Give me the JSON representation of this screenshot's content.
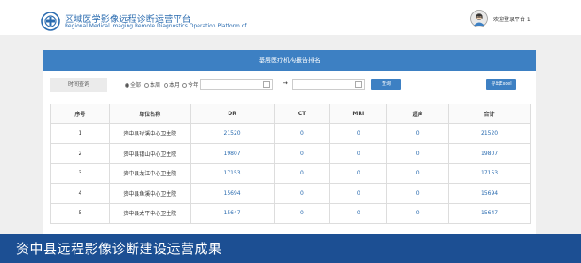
{
  "header": {
    "title_zh": "区域医学影像远程诊断运营平台",
    "title_en": "Regional Medical Imaging Remote Diagnostics Operation Platform of",
    "welcome": "欢迎登录平台 1",
    "logo_icon": "hospital-logo-icon",
    "avatar_icon": "user-avatar-icon"
  },
  "panel": {
    "title": "基层医疗机构报告排名"
  },
  "filter": {
    "label": "时间查询",
    "options": [
      "全部",
      "本周",
      "本月",
      "今年"
    ],
    "selected": "全部",
    "start_date": "",
    "end_date": "",
    "arrow": "→",
    "query_button": "查询",
    "export_button": "导出Excel"
  },
  "table": {
    "headers": [
      "序号",
      "单位名称",
      "DR",
      "CT",
      "MRI",
      "超声",
      "合计"
    ],
    "rows": [
      [
        "1",
        "资中县球溪中心卫生院",
        "21520",
        "0",
        "0",
        "0",
        "21520"
      ],
      [
        "2",
        "资中县银山中心卫生院",
        "19807",
        "0",
        "0",
        "0",
        "19807"
      ],
      [
        "3",
        "资中县龙江中心卫生院",
        "17153",
        "0",
        "0",
        "0",
        "17153"
      ],
      [
        "4",
        "资中县鱼溪中心卫生院",
        "15694",
        "0",
        "0",
        "0",
        "15694"
      ],
      [
        "5",
        "资中县太平中心卫生院",
        "15647",
        "0",
        "0",
        "0",
        "15647"
      ]
    ]
  },
  "banner": {
    "text": "资中县远程影像诊断建设运营成果"
  },
  "colors": {
    "accent": "#3d80c3",
    "banner": "#1c4f93",
    "link": "#2b6cb0"
  }
}
